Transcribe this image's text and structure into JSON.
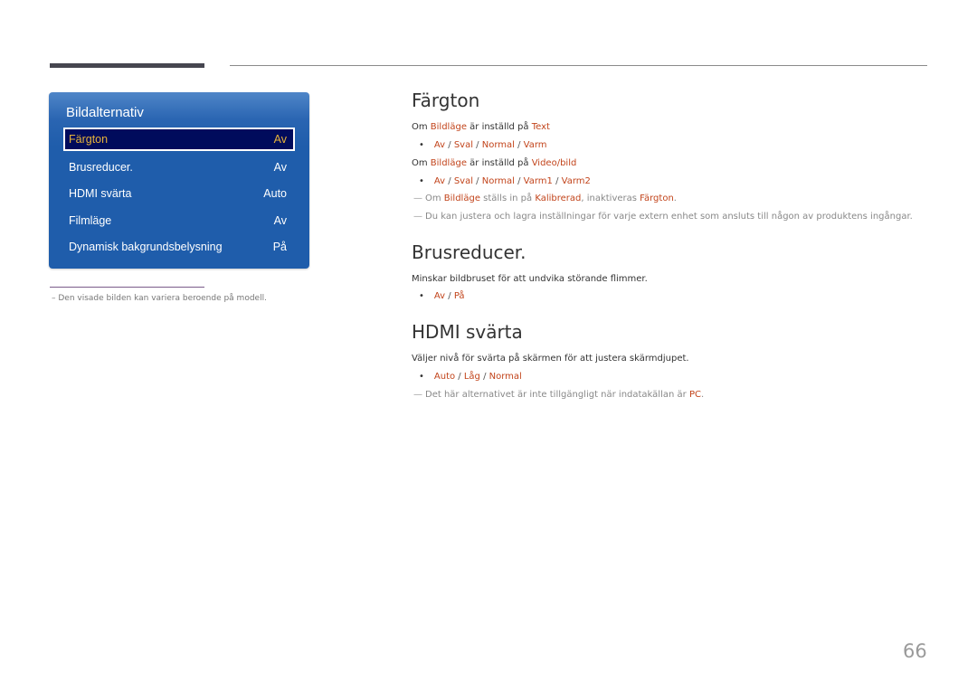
{
  "osd_menu": {
    "title": "Bildalternativ",
    "items": [
      {
        "label": "Färgton",
        "value": "Av",
        "selected": true
      },
      {
        "label": "Brusreducer.",
        "value": "Av"
      },
      {
        "label": "HDMI svärta",
        "value": "Auto"
      },
      {
        "label": "Filmläge",
        "value": "Av"
      },
      {
        "label": "Dynamisk bakgrundsbelysning",
        "value": "På"
      }
    ]
  },
  "footnote": "– Den visade bilden kan variera beroende på modell.",
  "sections": {
    "fargton": {
      "heading": "Färgton",
      "line1": {
        "pre": "Om ",
        "hl1": "Bildläge",
        "mid": " är inställd på ",
        "hl2": "Text"
      },
      "options1": [
        "Av",
        "Sval",
        "Normal",
        "Varm"
      ],
      "line2": {
        "pre": "Om ",
        "hl1": "Bildläge",
        "mid": " är inställd på ",
        "hl2": "Video/bild"
      },
      "options2": [
        "Av",
        "Sval",
        "Normal",
        "Varm1",
        "Varm2"
      ],
      "note1": {
        "pre": "Om ",
        "hl1": "Bildläge",
        "mid": " ställs in på ",
        "hl2": "Kalibrerad",
        "mid2": ", inaktiveras ",
        "hl3": "Färgton",
        "post": "."
      },
      "note2": "Du kan justera och lagra inställningar för varje extern enhet som ansluts till någon av produktens ingångar."
    },
    "brusreducer": {
      "heading": "Brusreducer.",
      "desc": "Minskar bildbruset för att undvika störande flimmer.",
      "options": [
        "Av",
        "På"
      ]
    },
    "hdmi": {
      "heading": "HDMI svärta",
      "desc": "Väljer nivå för svärta på skärmen för att justera skärmdjupet.",
      "options": [
        "Auto",
        "Låg",
        "Normal"
      ],
      "note": {
        "pre": "Det här alternativet är inte tillgängligt när indatakällan är ",
        "hl": "PC",
        "post": "."
      }
    }
  },
  "symbols": {
    "bullet": "•",
    "separator": " / ",
    "note_mark": "—"
  },
  "page_number": "66",
  "colors": {
    "accent": "#c2441b",
    "osd_blue": "#1f5dab",
    "osd_selected": "#000b5c",
    "osd_selected_text": "#e7b33a"
  }
}
